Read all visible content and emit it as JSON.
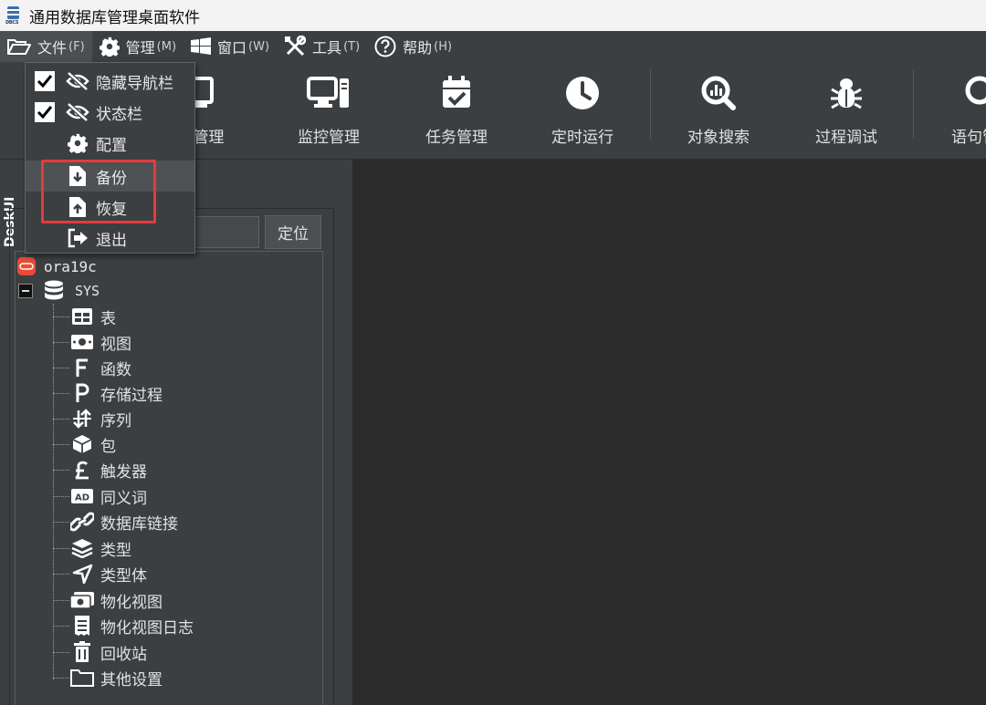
{
  "window": {
    "title": "通用数据库管理桌面软件",
    "icon_label": "DBCS",
    "icon": "database-stack-icon"
  },
  "menubar": {
    "items": [
      {
        "label": "文件",
        "accel": "(F)",
        "icon": "folder-open-icon"
      },
      {
        "label": "管理",
        "accel": "(M)",
        "icon": "gear-icon"
      },
      {
        "label": "窗口",
        "accel": "(W)",
        "icon": "windows-icon"
      },
      {
        "label": "工具",
        "accel": "(T)",
        "icon": "tools-icon"
      },
      {
        "label": "帮助",
        "accel": "(H)",
        "icon": "help-circle-icon"
      }
    ]
  },
  "toolbar": {
    "items": [
      {
        "label": "库管理",
        "icon": "server-icon"
      },
      {
        "label": "监控管理",
        "icon": "monitor-icon"
      },
      {
        "label": "任务管理",
        "icon": "calendar-check-icon"
      },
      {
        "label": "定时运行",
        "icon": "clock-icon"
      },
      {
        "label": "对象搜索",
        "icon": "search-chart-icon"
      },
      {
        "label": "过程调试",
        "icon": "bug-icon"
      },
      {
        "label": "语句管理",
        "icon": "search-icon"
      }
    ]
  },
  "file_menu": {
    "items": [
      {
        "label": "隐藏导航栏",
        "checked": true,
        "icon": "eye-slash-icon"
      },
      {
        "label": "状态栏",
        "checked": true,
        "icon": "eye-slash-icon"
      },
      {
        "label": "配置",
        "icon": "gear-icon"
      },
      {
        "label": "备份",
        "icon": "file-download-icon",
        "highlighted": true
      },
      {
        "label": "恢复",
        "icon": "file-upload-icon"
      },
      {
        "label": "退出",
        "icon": "sign-out-icon"
      }
    ]
  },
  "side_tab": {
    "label": "DeskUI"
  },
  "navigator": {
    "locate_label": "定位",
    "search_value": "",
    "connection": {
      "label": "ora19c",
      "icon": "oracle-icon"
    },
    "schema": {
      "label": "SYS",
      "icon": "database-icon",
      "expanded": true
    },
    "nodes": [
      {
        "label": "表",
        "icon": "table-icon"
      },
      {
        "label": "视图",
        "icon": "view-icon"
      },
      {
        "label": "函数",
        "icon": "function-f-icon"
      },
      {
        "label": "存储过程",
        "icon": "procedure-p-icon"
      },
      {
        "label": "序列",
        "icon": "sequence-icon"
      },
      {
        "label": "包",
        "icon": "package-cube-icon"
      },
      {
        "label": "触发器",
        "icon": "trigger-pound-icon"
      },
      {
        "label": "同义词",
        "icon": "synonym-ad-icon"
      },
      {
        "label": "数据库链接",
        "icon": "link-icon"
      },
      {
        "label": "类型",
        "icon": "layers-icon"
      },
      {
        "label": "类型体",
        "icon": "type-body-icon"
      },
      {
        "label": "物化视图",
        "icon": "materialized-view-icon"
      },
      {
        "label": "物化视图日志",
        "icon": "receipt-icon"
      },
      {
        "label": "回收站",
        "icon": "trash-icon"
      },
      {
        "label": "其他设置",
        "icon": "folder-icon"
      }
    ]
  },
  "colors": {
    "background": "#3c3f41",
    "workspace": "#2b2b2b",
    "highlight_box": "#e53b3b",
    "title_bar": "#f3f3f3"
  }
}
